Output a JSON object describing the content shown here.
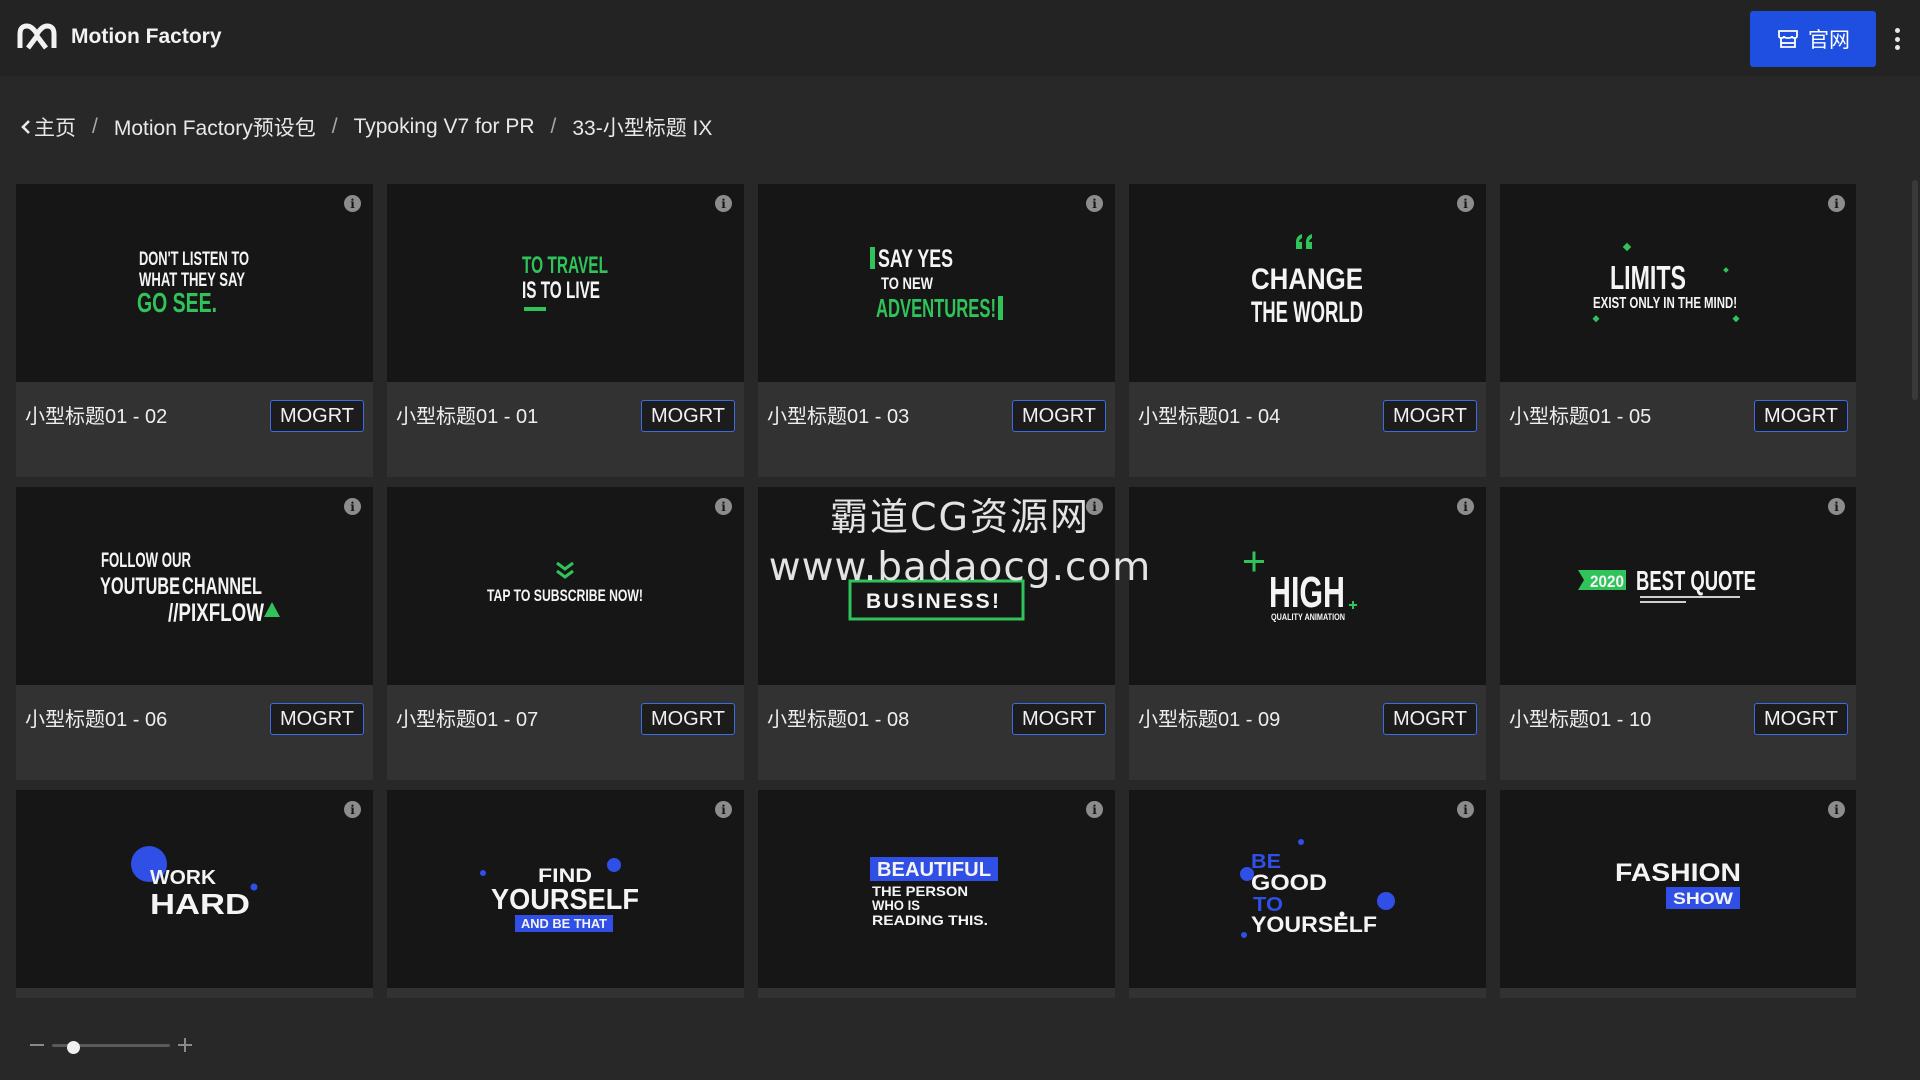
{
  "header": {
    "app_title": "Motion Factory",
    "site_button_label": "官网",
    "icons": {
      "logo": "motion-factory-logo",
      "site": "storefront-icon",
      "menu": "kebab-menu-icon"
    }
  },
  "breadcrumb": {
    "items": [
      "主页",
      "Motion Factory预设包",
      "Typoking V7 for PR",
      "33-小型标题 IX"
    ],
    "separator": "/"
  },
  "cards": [
    {
      "title": "小型标题01 - 02",
      "badge": "MOGRT",
      "preview": [
        "DON'T LISTEN TO",
        "WHAT THEY SAY",
        "GO SEE."
      ]
    },
    {
      "title": "小型标题01 - 01",
      "badge": "MOGRT",
      "preview": [
        "TO TRAVEL",
        "IS TO LIVE"
      ]
    },
    {
      "title": "小型标题01 - 03",
      "badge": "MOGRT",
      "preview": [
        "SAY YES",
        "TO NEW",
        "ADVENTURES!"
      ]
    },
    {
      "title": "小型标题01 - 04",
      "badge": "MOGRT",
      "preview": [
        "CHANGE",
        "THE WORLD"
      ]
    },
    {
      "title": "小型标题01 - 05",
      "badge": "MOGRT",
      "preview": [
        "LIMITS",
        "EXIST ONLY IN THE",
        "MIND!"
      ]
    },
    {
      "title": "小型标题01 - 06",
      "badge": "MOGRT",
      "preview": [
        "FOLLOW OUR",
        "YOUTUBE",
        "CHANNEL",
        "//PIXFLOW"
      ]
    },
    {
      "title": "小型标题01 - 07",
      "badge": "MOGRT",
      "preview": [
        "TAP TO SUBSCRIBE NOW!"
      ]
    },
    {
      "title": "小型标题01 - 08",
      "badge": "MOGRT",
      "preview": [
        "BUSINESS!"
      ]
    },
    {
      "title": "小型标题01 - 09",
      "badge": "MOGRT",
      "preview": [
        "HIGH",
        "QUALITY ANIMATION"
      ]
    },
    {
      "title": "小型标题01 - 10",
      "badge": "MOGRT",
      "preview": [
        "2020",
        "BEST QUOTE"
      ]
    },
    {
      "title": "",
      "badge": "",
      "preview": [
        "WORK",
        "HARD"
      ]
    },
    {
      "title": "",
      "badge": "",
      "preview": [
        "FIND",
        "YOURSELF",
        "AND BE THAT"
      ]
    },
    {
      "title": "",
      "badge": "",
      "preview": [
        "BEAUTIFUL",
        "THE PERSON",
        "WHO IS",
        "READING THIS."
      ]
    },
    {
      "title": "",
      "badge": "",
      "preview": [
        "BE",
        "GOOD",
        "TO",
        "YOURSELF"
      ]
    },
    {
      "title": "",
      "badge": "",
      "preview": [
        "FASHION",
        "SHOW"
      ]
    }
  ],
  "watermark": {
    "line1": "霸道CG资源网",
    "line2": "www.badaocg.com"
  },
  "zoom": {
    "level": 0.18
  },
  "colors": {
    "accent": "#1e4fe0",
    "green": "#2fc35a",
    "blue": "#2f4fe6",
    "background": "#282828"
  }
}
